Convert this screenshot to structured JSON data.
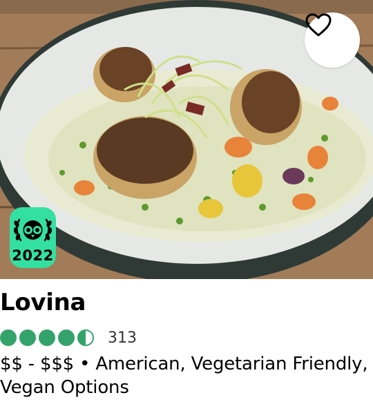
{
  "listing": {
    "name": "Lovina",
    "rating_value": 4.5,
    "rating_max": 5,
    "review_count": "313",
    "price_range": "$$ - $$$",
    "separator": "•",
    "cuisines": "American, Vegetarian Friendly, Vegan Options"
  },
  "badge": {
    "year": "2022",
    "icon": "tripadvisor-owl-laurel-icon",
    "color": "#34e0a1"
  },
  "photo": {
    "subject": "seared-scallops-risotto-image"
  },
  "save_button": {
    "icon": "heart-outline-icon"
  },
  "colors": {
    "bubble": "#34a36b",
    "badge": "#34e0a1"
  }
}
